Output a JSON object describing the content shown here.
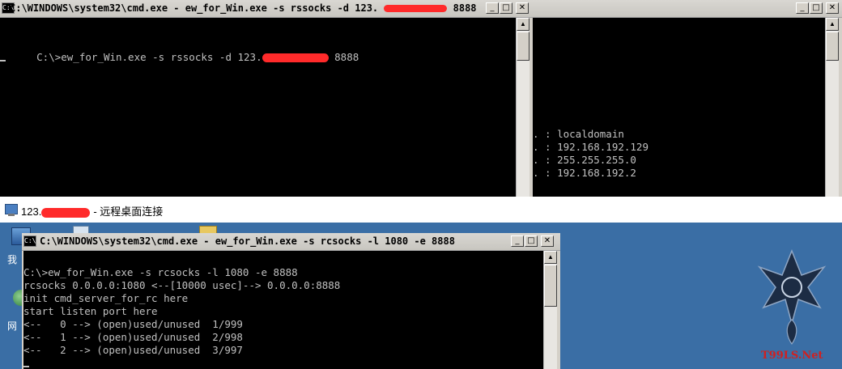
{
  "window_left": {
    "title": "C:\\WINDOWS\\system32\\cmd.exe - ew_for_Win.exe -s rssocks -d 123.",
    "title_tail": "8888",
    "lines": [
      "C:\\>ew_for_Win.exe -s rssocks -d 123."
    ],
    "line_tail": "8888"
  },
  "window_right": {
    "lines": [
      ". : localdomain",
      ". : 192.168.192.129",
      ". : 255.255.255.0",
      ". : 192.168.192.2"
    ]
  },
  "rdp_bar": {
    "title_prefix": "123.",
    "title_suffix": "- 远程桌面连接"
  },
  "desktop": {
    "icon_label_1": "我",
    "icon_label_2": "网",
    "watermark": "T99LS.Net"
  },
  "window_bottom": {
    "title": "C:\\WINDOWS\\system32\\cmd.exe - ew_for_Win.exe -s rcsocks -l 1080 -e 8888",
    "lines": [
      "C:\\>ew_for_Win.exe -s rcsocks -l 1080 -e 8888",
      "rcsocks 0.0.0.0:1080 <--[10000 usec]--> 0.0.0.0:8888",
      "init cmd_server_for_rc here",
      "start listen port here",
      "<--   0 --> (open)used/unused  1/999",
      "<--   1 --> (open)used/unused  2/998",
      "<--   2 --> (open)used/unused  3/997"
    ]
  },
  "colors": {
    "console_bg": "#000000",
    "console_text": "#c0c0c0",
    "redaction": "#ff2a2a",
    "desktop_blue": "#3a6ea5",
    "watermark_red": "#d02020"
  }
}
